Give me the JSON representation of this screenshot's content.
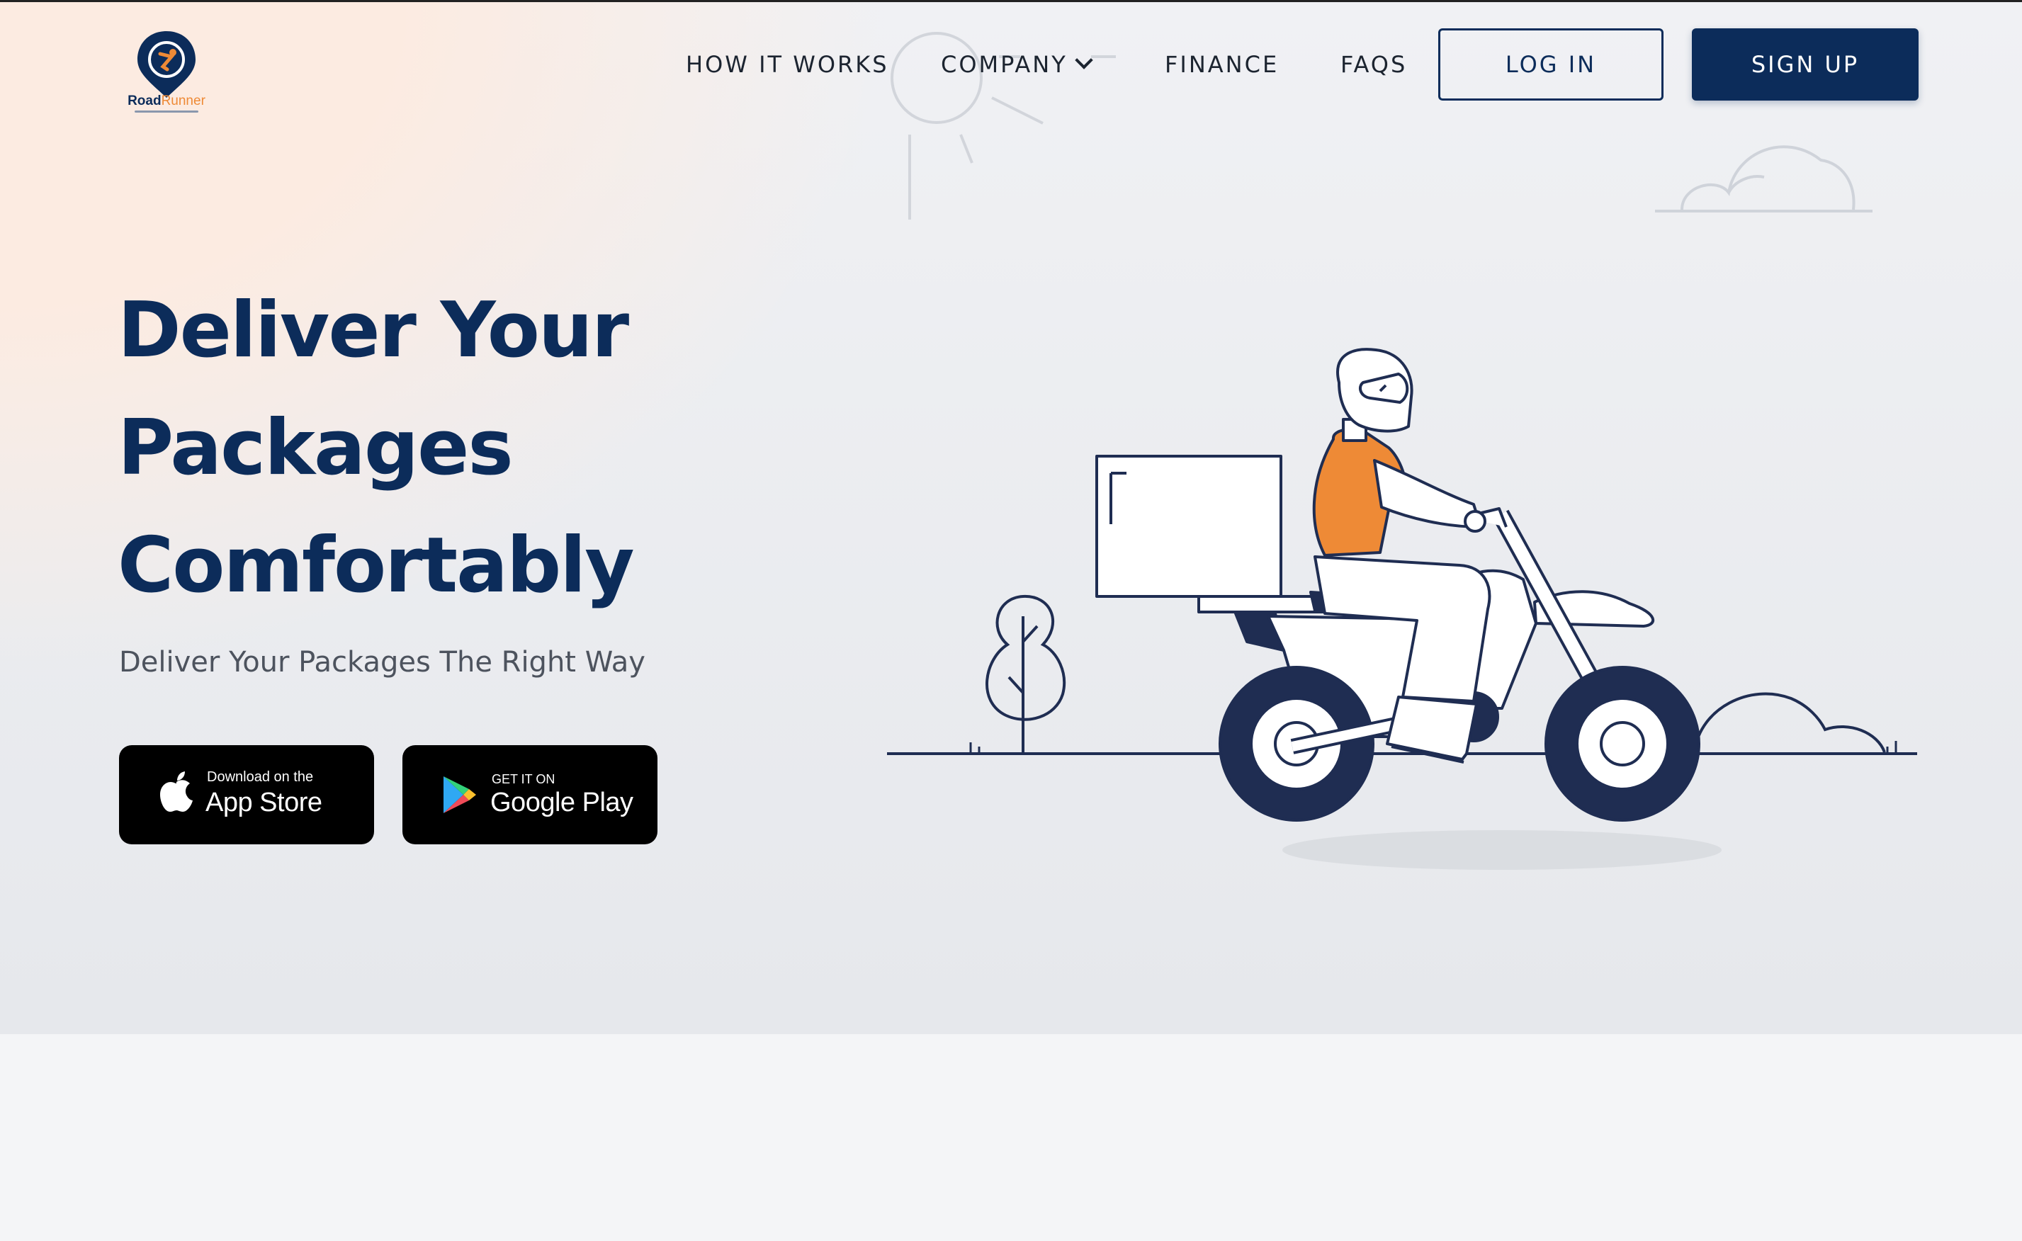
{
  "brand": {
    "name_part1": "Road",
    "name_part2": "Runner",
    "colors": {
      "navy": "#0c2c5a",
      "orange": "#ee8a36"
    }
  },
  "nav": {
    "items": [
      {
        "label": "HOW IT WORKS"
      },
      {
        "label": "COMPANY",
        "icon": "chevron-down-icon"
      },
      {
        "label": "FINANCE"
      },
      {
        "label": "FAQS"
      }
    ],
    "login_label": "LOG IN",
    "signup_label": "SIGN UP"
  },
  "hero": {
    "headline_lines": [
      "Deliver Your",
      "Packages",
      "Comfortably"
    ],
    "subheadline": "Deliver Your Packages The Right Way",
    "app_store": {
      "small": "Download on the",
      "big": "App Store",
      "icon": "apple-icon"
    },
    "google_play": {
      "small": "GET IT ON",
      "big": "Google Play",
      "icon": "google-play-icon"
    },
    "illustration": "delivery-rider-illustration"
  }
}
